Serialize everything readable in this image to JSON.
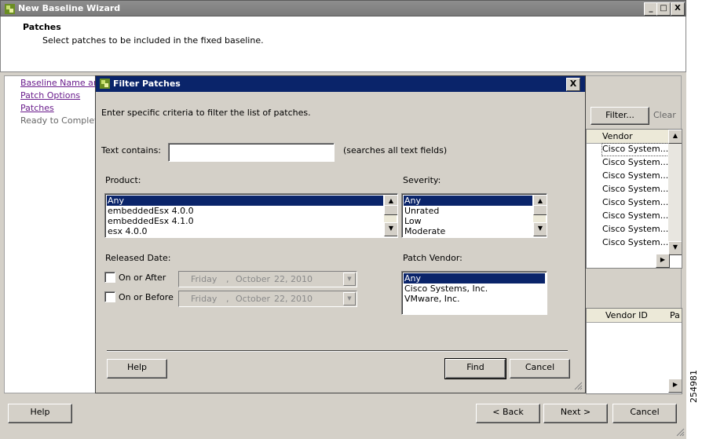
{
  "window": {
    "title": "New Baseline Wizard",
    "minimize": "_",
    "maximize": "□",
    "close": "X"
  },
  "header": {
    "title": "Patches",
    "subtitle": "Select patches to be included in the fixed baseline."
  },
  "nav": {
    "items": [
      {
        "label": "Baseline Name and",
        "link": true
      },
      {
        "label": "Patch Options",
        "link": true
      },
      {
        "label": "Patches",
        "link": true
      },
      {
        "label": "Ready to Complete",
        "link": false
      }
    ]
  },
  "right_panel": {
    "filter_button": "Filter...",
    "clear_link": "Clear",
    "vendor_header": "Vendor",
    "vendor_rows": [
      "Cisco System...",
      "Cisco System...",
      "Cisco System...",
      "Cisco System...",
      "Cisco System...",
      "Cisco System...",
      "Cisco System...",
      "Cisco System..."
    ],
    "lower_headers": [
      "Vendor ID",
      "Pa"
    ]
  },
  "dialog": {
    "title": "Filter Patches",
    "close": "X",
    "instructions": "Enter specific criteria to filter the list of patches.",
    "text_contains_label": "Text  contains:",
    "text_contains_value": "",
    "text_hint": "(searches all text fields)",
    "product_label": "Product:",
    "product_options": [
      "Any",
      "embeddedEsx 4.0.0",
      "embeddedEsx 4.1.0",
      "esx 4.0.0"
    ],
    "severity_label": "Severity:",
    "severity_options": [
      "Any",
      "Unrated",
      "Low",
      "Moderate"
    ],
    "released_date_label": "Released Date:",
    "on_or_after_label": "On or After",
    "on_or_before_label": "On or Before",
    "date_after": {
      "day": "Friday",
      "sep": ",",
      "month": "October",
      "date": "22, 2010"
    },
    "date_before": {
      "day": "Friday",
      "sep": ",",
      "month": "October",
      "date": "22, 2010"
    },
    "patch_vendor_label": "Patch Vendor:",
    "vendor_options": [
      "Any",
      "Cisco Systems, Inc.",
      "VMware, Inc."
    ],
    "help_button": "Help",
    "find_button": "Find",
    "cancel_button": "Cancel"
  },
  "footer": {
    "help_button": "Help",
    "back_button": "< Back",
    "next_button": "Next >",
    "cancel_button": "Cancel"
  },
  "figure_id": "254981"
}
